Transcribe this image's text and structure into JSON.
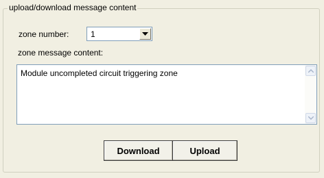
{
  "group": {
    "title": "upload/download message content"
  },
  "zone_number": {
    "label": "zone number:",
    "value": "1"
  },
  "message": {
    "label": "zone message content:",
    "value": "Module uncompleted circuit triggering zone"
  },
  "buttons": {
    "download": "Download",
    "upload": "Upload"
  },
  "icons": {
    "combo": "chevron-down-icon",
    "scroll_up": "scroll-up-arrow-icon",
    "scroll_down": "scroll-down-arrow-icon"
  }
}
